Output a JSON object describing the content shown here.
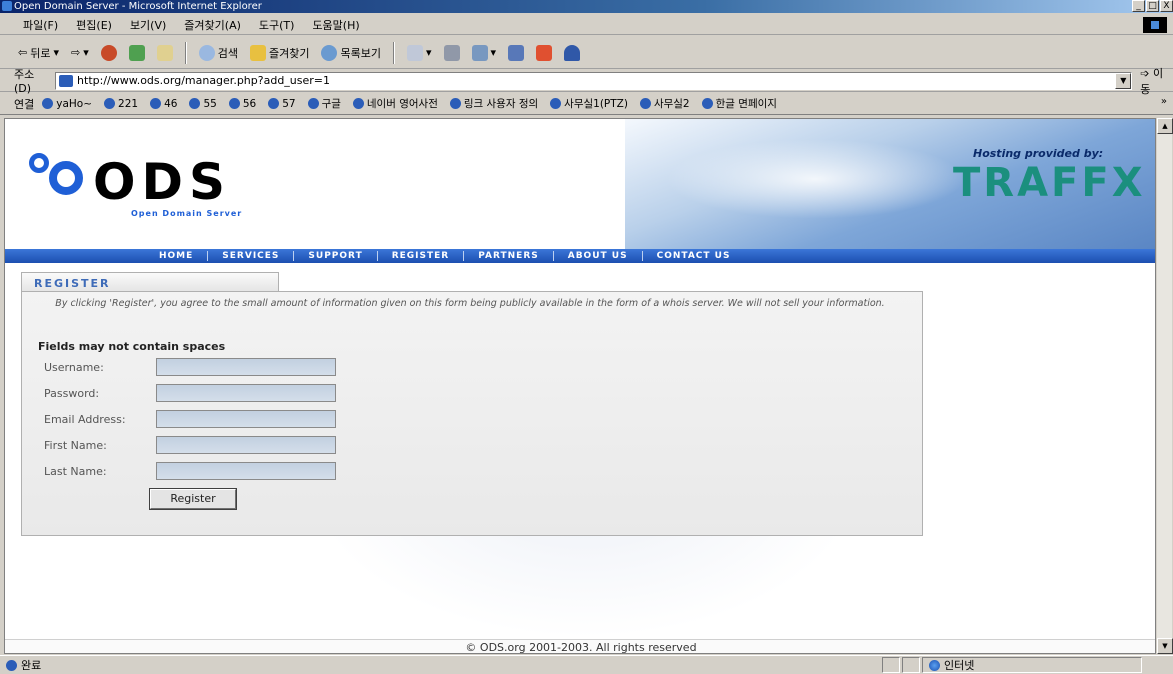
{
  "window": {
    "title": "Open Domain Server - Microsoft Internet Explorer",
    "controls": [
      "_",
      "□",
      "X"
    ]
  },
  "menu": [
    "파일(F)",
    "편집(E)",
    "보기(V)",
    "즐겨찾기(A)",
    "도구(T)",
    "도움말(H)"
  ],
  "toolbar": {
    "back": "뒤로",
    "search": "검색",
    "favorites": "즐겨찾기",
    "history": "목록보기"
  },
  "address": {
    "label": "주소(D)",
    "url": "http://www.ods.org/manager.php?add_user=1",
    "go": "이동"
  },
  "links": {
    "label": "연결",
    "items": [
      "yaHo~",
      "221",
      "46",
      "55",
      "56",
      "57",
      "구글",
      "네이버 영어사전",
      "링크 사용자 정의",
      "사무실1(PTZ)",
      "사무실2",
      "한글 면페이지"
    ]
  },
  "banner": {
    "logo": "ODS",
    "tagline": "Open Domain Server",
    "hosting": "Hosting provided by:",
    "sponsor": "TRAFFX"
  },
  "nav": [
    "HOME",
    "SERVICES",
    "SUPPORT",
    "REGISTER",
    "PARTNERS",
    "ABOUT US",
    "CONTACT US"
  ],
  "register": {
    "title": "Register",
    "notice": "By clicking 'Register', you agree to the small amount of information given on this form being publicly available in the form of a whois server. We will not sell your information.",
    "fields_title": "Fields may not contain spaces",
    "fields": [
      {
        "label": "Username:",
        "value": ""
      },
      {
        "label": "Password:",
        "value": ""
      },
      {
        "label": "Email Address:",
        "value": ""
      },
      {
        "label": "First Name:",
        "value": ""
      },
      {
        "label": "Last Name:",
        "value": ""
      }
    ],
    "button": "Register"
  },
  "footer": "© ODS.org 2001-2003. All rights reserved",
  "status": {
    "text": "완료",
    "zone": "인터넷"
  },
  "colors": {
    "nav": "#1c4fb0",
    "brand": "#1f5fd6",
    "sponsor": "#1b8f7e"
  }
}
